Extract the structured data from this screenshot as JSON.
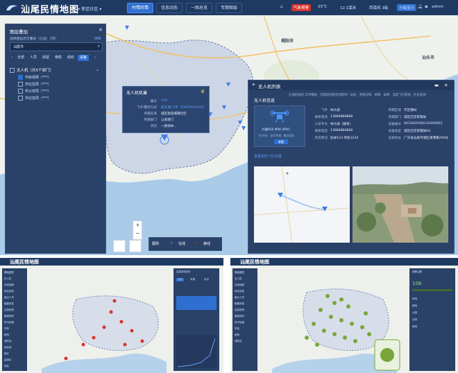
{
  "app": {
    "title": "汕尾民情地图",
    "location": "新区社区"
  },
  "nav": {
    "tabs": [
      {
        "label": "村情民情",
        "active": true
      },
      {
        "label": "信息动态",
        "active": false
      },
      {
        "label": "一图总览",
        "active": false
      },
      {
        "label": "专题图层",
        "active": false
      }
    ]
  },
  "status": {
    "alert": "气象预警",
    "temp": "25℃",
    "rain": "12.1毫米",
    "wind": "西南风 3级",
    "user_box": "分级显示",
    "user": "admin"
  },
  "layer_panel": {
    "title": "图层叠加",
    "hint": "选择图层后可叠加（已选：1项）",
    "clear": "清除",
    "search_value": "汕尾市",
    "chips": [
      {
        "label": "全部",
        "on": false
      },
      {
        "label": "人员",
        "on": false
      },
      {
        "label": "房屋",
        "on": false
      },
      {
        "label": "维稳",
        "on": false
      },
      {
        "label": "组织",
        "on": false
      },
      {
        "label": "设备",
        "on": true
      }
    ],
    "group": "无人机（共5个部门）",
    "items": [
      {
        "label": "市级视频（***）",
        "checked": true
      },
      {
        "label": "市应急局（***）",
        "checked": false
      },
      {
        "label": "市公安局（***）",
        "checked": false
      },
      {
        "label": "市应急局（***）",
        "checked": false
      }
    ]
  },
  "popup": {
    "title": "无人机机巢",
    "rows": [
      {
        "label": "编号",
        "value": "XXX"
      },
      {
        "label": "飞手/服务方式",
        "value": "航天城/飞手（XXXXXXXXXX）"
      },
      {
        "label": "所属区域",
        "value": "城区街道城镇社区"
      },
      {
        "label": "所属部门",
        "value": "公安部门"
      },
      {
        "label": "状态",
        "value": "一级待命..."
      }
    ]
  },
  "detail": {
    "title": "无人机列表",
    "section": "无人机信息",
    "status_line": "在线航拍机 实时播报 · 可能遥测受机场影响 · 返航 · 查看详情 · 视频 · 录像 · 追踪飞行航线 · 历史航线",
    "device_name": "大疆M30 MINI 4PRO",
    "device_spec": "飞行时长 · 信号传输 · 最远距离",
    "device_button": "查看",
    "fields_left": [
      {
        "label": "飞手",
        "value": "林大威"
      },
      {
        "label": "联系电话",
        "value": "13888888888"
      },
      {
        "label": "公安专员",
        "value": "林大威（联系）"
      },
      {
        "label": "联系电话",
        "value": "13888888888"
      },
      {
        "label": "状态情况",
        "value": "纪录123  待巡1234"
      }
    ],
    "fields_right": [
      {
        "label": "所属区域",
        "value": "市区镇村"
      },
      {
        "label": "所属部门",
        "value": "城区应急管理局"
      },
      {
        "label": "设备编号",
        "value": "4415620100132400002"
      },
      {
        "label": "设备类型",
        "value": "城区应急管理局04"
      },
      {
        "label": "设备地址",
        "value": "广东省汕尾市城区通港路260号"
      }
    ],
    "link": "查看实时飞行记录"
  },
  "legend": {
    "label": "图例",
    "online": "在线",
    "offline": "离线"
  },
  "map_labels": {
    "jieyang": "揭阳市",
    "shantou": "汕头市"
  },
  "thumb_left": {
    "title": "汕尾民情地图",
    "side_items": [
      "基础图层",
      "无人机",
      "在线视频",
      "综合信息",
      "重点人员",
      "隐患排查",
      "应急物资",
      "避难场所",
      "防汛设施",
      "学校",
      "医院",
      "消防站",
      "危化品",
      "景区",
      "监测点",
      "地名"
    ],
    "panel_title": "应急事件统计",
    "panel_tabs": [
      "今日",
      "本周",
      "本月"
    ]
  },
  "thumb_right": {
    "title": "汕尾民情地图",
    "side_items": [
      "基础图层",
      "无人机",
      "在线视频",
      "综合信息",
      "重点人员",
      "隐患排查",
      "应急物资",
      "避难场所",
      "防汛设施",
      "学校",
      "医院",
      "消防站"
    ],
    "panel_title": "绿美汕尾",
    "panel_value": "108",
    "legend_items": [
      "林地",
      "绿地",
      "公园",
      "古树",
      "湿地"
    ]
  },
  "colors": {
    "topbar": "#1e3a63",
    "panel": "#2a4168",
    "accent": "#2f6fd1",
    "sea": "#a9cbe8",
    "land": "#eef1ec",
    "alert": "#d8322b"
  },
  "icons": [
    "logo-icon",
    "location-pin-icon",
    "search-icon",
    "close-icon",
    "chevron-down-icon",
    "drone-icon",
    "bell-icon",
    "user-icon",
    "minimize-icon",
    "maximize-icon"
  ]
}
